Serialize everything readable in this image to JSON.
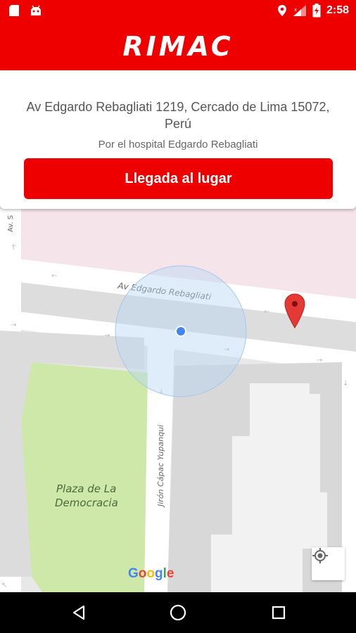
{
  "status_bar": {
    "time": "2:58"
  },
  "app_bar": {
    "logo_text": "RIMAC",
    "background_color": "#ee0000"
  },
  "card": {
    "address": "Av Edgardo Rebagliati 1219, Cercado de Lima 15072, Perú",
    "reference": "Por el hospital Edgardo Rebagliati",
    "arrive_button_label": "Llegada al lugar"
  },
  "map": {
    "street_labels": {
      "av_edgardo": "Av Edgardo Rebagliati",
      "jiron_cahuide_cut": "Av. S",
      "jiron_capac": "Jirón Cápac Yupanqui"
    },
    "park_label": "Plaza de La Democracia",
    "attribution": "Google"
  },
  "nav_bar": {
    "back_icon": "back-icon",
    "home_icon": "home-icon",
    "recents_icon": "recents-icon"
  }
}
